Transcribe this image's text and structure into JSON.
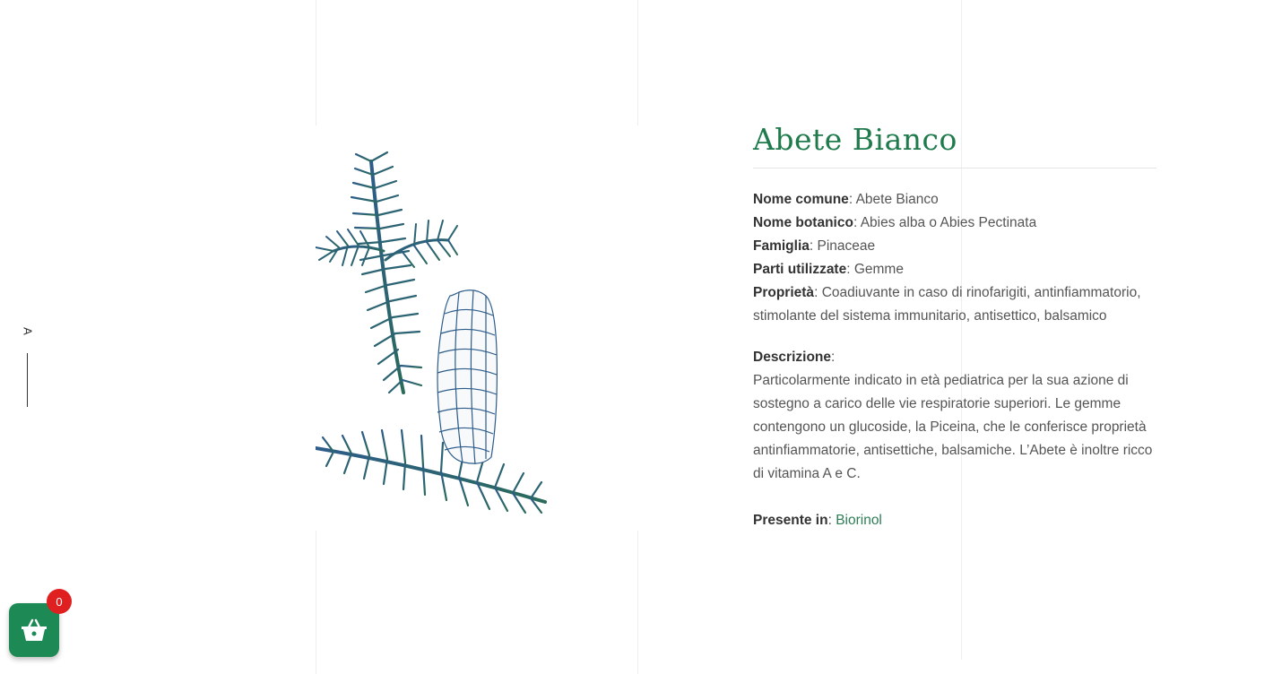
{
  "side_nav": {
    "letter": "A"
  },
  "plant": {
    "title": "Abete Bianco",
    "facts": [
      {
        "label": "Nome comune",
        "value": "Abete Bianco"
      },
      {
        "label": "Nome botanico",
        "value": "Abies alba o Abies Pectinata"
      },
      {
        "label": "Famiglia",
        "value": "Pinaceae"
      },
      {
        "label": "Parti utilizzate",
        "value": "Gemme"
      },
      {
        "label": "Proprietà",
        "value": "Coadiuvante in caso di rinofarigiti, antinfiammatorio, stimolante del sistema immunitario, antisettico, balsamico"
      }
    ],
    "description_label": "Descrizione",
    "description": "Particolarmente indicato in età pediatrica per la sua azione di sostegno a carico delle vie respiratorie superiori. Le gemme contengono un glucoside, la Piceina, che le conferisce proprietà antinfiammatorie, antisettiche, balsamiche. L’Abete è inoltre ricco di vitamina A e C.",
    "present_label": "Presente in",
    "present_link": "Biorinol"
  },
  "cart": {
    "count": "0",
    "icon": "basket-icon",
    "color": "#1d8a55",
    "badge_color": "#e02020"
  },
  "colors": {
    "title": "#1f7a4c",
    "link": "#2e7d55"
  }
}
